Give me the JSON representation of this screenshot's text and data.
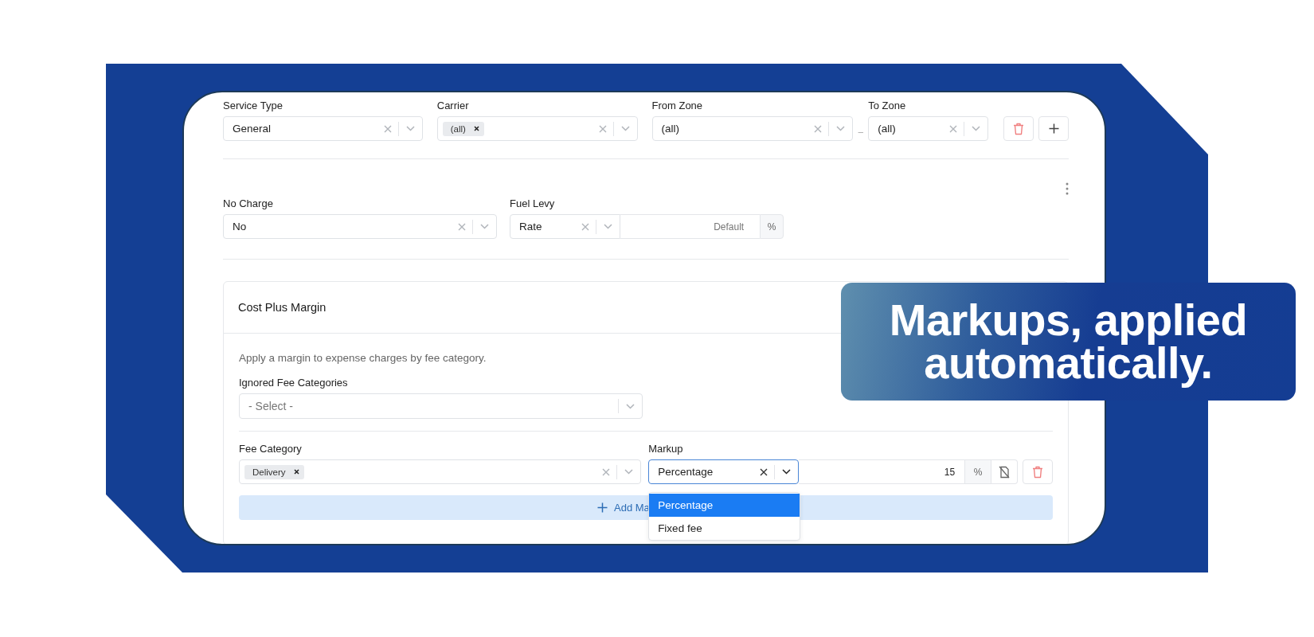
{
  "filters": [
    {
      "label": "Service Type",
      "value": "General",
      "kind": "text"
    },
    {
      "label": "Carrier",
      "value": "(all)",
      "kind": "tag"
    },
    {
      "label": "From Zone",
      "value": "(all)",
      "kind": "text"
    },
    {
      "label": "To Zone",
      "value": "(all)",
      "kind": "text"
    }
  ],
  "zone_separator": "_",
  "settings": [
    {
      "label": "No Charge",
      "value": "No",
      "kind": "select"
    },
    {
      "label": "Fuel Levy",
      "value": "Rate",
      "kind": "select_rate",
      "placeholder": "Default",
      "unit": "%"
    }
  ],
  "panel": {
    "title": "Cost Plus Margin",
    "description": "Apply a margin to expense charges by fee category.",
    "ignored": {
      "label": "Ignored Fee Categories",
      "placeholder": "- Select -"
    },
    "rows": [
      {
        "fee_label": "Fee Category",
        "fee_tag": "Delivery",
        "markup_label": "Markup",
        "markup_value": "Percentage",
        "focused": true,
        "amount": "15",
        "unit": "%"
      }
    ],
    "add_button": "Add Ma",
    "dropdown": [
      {
        "label": "Percentage",
        "selected": true
      },
      {
        "label": "Fixed fee",
        "selected": false
      }
    ]
  },
  "callout": {
    "lines": [
      "Markups, applied",
      "automatically."
    ]
  }
}
